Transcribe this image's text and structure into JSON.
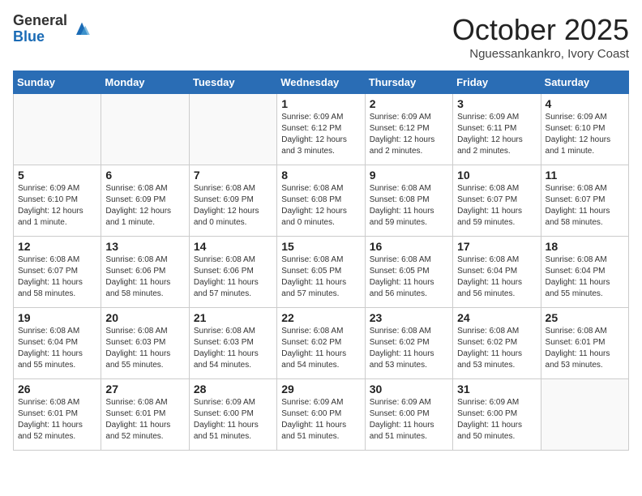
{
  "logo": {
    "general": "General",
    "blue": "Blue"
  },
  "title": "October 2025",
  "subtitle": "Nguessankankro, Ivory Coast",
  "headers": [
    "Sunday",
    "Monday",
    "Tuesday",
    "Wednesday",
    "Thursday",
    "Friday",
    "Saturday"
  ],
  "days": [
    {
      "num": "",
      "info": ""
    },
    {
      "num": "",
      "info": ""
    },
    {
      "num": "",
      "info": ""
    },
    {
      "num": "1",
      "info": "Sunrise: 6:09 AM\nSunset: 6:12 PM\nDaylight: 12 hours\nand 3 minutes."
    },
    {
      "num": "2",
      "info": "Sunrise: 6:09 AM\nSunset: 6:12 PM\nDaylight: 12 hours\nand 2 minutes."
    },
    {
      "num": "3",
      "info": "Sunrise: 6:09 AM\nSunset: 6:11 PM\nDaylight: 12 hours\nand 2 minutes."
    },
    {
      "num": "4",
      "info": "Sunrise: 6:09 AM\nSunset: 6:10 PM\nDaylight: 12 hours\nand 1 minute."
    },
    {
      "num": "5",
      "info": "Sunrise: 6:09 AM\nSunset: 6:10 PM\nDaylight: 12 hours\nand 1 minute."
    },
    {
      "num": "6",
      "info": "Sunrise: 6:08 AM\nSunset: 6:09 PM\nDaylight: 12 hours\nand 1 minute."
    },
    {
      "num": "7",
      "info": "Sunrise: 6:08 AM\nSunset: 6:09 PM\nDaylight: 12 hours\nand 0 minutes."
    },
    {
      "num": "8",
      "info": "Sunrise: 6:08 AM\nSunset: 6:08 PM\nDaylight: 12 hours\nand 0 minutes."
    },
    {
      "num": "9",
      "info": "Sunrise: 6:08 AM\nSunset: 6:08 PM\nDaylight: 11 hours\nand 59 minutes."
    },
    {
      "num": "10",
      "info": "Sunrise: 6:08 AM\nSunset: 6:07 PM\nDaylight: 11 hours\nand 59 minutes."
    },
    {
      "num": "11",
      "info": "Sunrise: 6:08 AM\nSunset: 6:07 PM\nDaylight: 11 hours\nand 58 minutes."
    },
    {
      "num": "12",
      "info": "Sunrise: 6:08 AM\nSunset: 6:07 PM\nDaylight: 11 hours\nand 58 minutes."
    },
    {
      "num": "13",
      "info": "Sunrise: 6:08 AM\nSunset: 6:06 PM\nDaylight: 11 hours\nand 58 minutes."
    },
    {
      "num": "14",
      "info": "Sunrise: 6:08 AM\nSunset: 6:06 PM\nDaylight: 11 hours\nand 57 minutes."
    },
    {
      "num": "15",
      "info": "Sunrise: 6:08 AM\nSunset: 6:05 PM\nDaylight: 11 hours\nand 57 minutes."
    },
    {
      "num": "16",
      "info": "Sunrise: 6:08 AM\nSunset: 6:05 PM\nDaylight: 11 hours\nand 56 minutes."
    },
    {
      "num": "17",
      "info": "Sunrise: 6:08 AM\nSunset: 6:04 PM\nDaylight: 11 hours\nand 56 minutes."
    },
    {
      "num": "18",
      "info": "Sunrise: 6:08 AM\nSunset: 6:04 PM\nDaylight: 11 hours\nand 55 minutes."
    },
    {
      "num": "19",
      "info": "Sunrise: 6:08 AM\nSunset: 6:04 PM\nDaylight: 11 hours\nand 55 minutes."
    },
    {
      "num": "20",
      "info": "Sunrise: 6:08 AM\nSunset: 6:03 PM\nDaylight: 11 hours\nand 55 minutes."
    },
    {
      "num": "21",
      "info": "Sunrise: 6:08 AM\nSunset: 6:03 PM\nDaylight: 11 hours\nand 54 minutes."
    },
    {
      "num": "22",
      "info": "Sunrise: 6:08 AM\nSunset: 6:02 PM\nDaylight: 11 hours\nand 54 minutes."
    },
    {
      "num": "23",
      "info": "Sunrise: 6:08 AM\nSunset: 6:02 PM\nDaylight: 11 hours\nand 53 minutes."
    },
    {
      "num": "24",
      "info": "Sunrise: 6:08 AM\nSunset: 6:02 PM\nDaylight: 11 hours\nand 53 minutes."
    },
    {
      "num": "25",
      "info": "Sunrise: 6:08 AM\nSunset: 6:01 PM\nDaylight: 11 hours\nand 53 minutes."
    },
    {
      "num": "26",
      "info": "Sunrise: 6:08 AM\nSunset: 6:01 PM\nDaylight: 11 hours\nand 52 minutes."
    },
    {
      "num": "27",
      "info": "Sunrise: 6:08 AM\nSunset: 6:01 PM\nDaylight: 11 hours\nand 52 minutes."
    },
    {
      "num": "28",
      "info": "Sunrise: 6:09 AM\nSunset: 6:00 PM\nDaylight: 11 hours\nand 51 minutes."
    },
    {
      "num": "29",
      "info": "Sunrise: 6:09 AM\nSunset: 6:00 PM\nDaylight: 11 hours\nand 51 minutes."
    },
    {
      "num": "30",
      "info": "Sunrise: 6:09 AM\nSunset: 6:00 PM\nDaylight: 11 hours\nand 51 minutes."
    },
    {
      "num": "31",
      "info": "Sunrise: 6:09 AM\nSunset: 6:00 PM\nDaylight: 11 hours\nand 50 minutes."
    },
    {
      "num": "",
      "info": ""
    }
  ]
}
